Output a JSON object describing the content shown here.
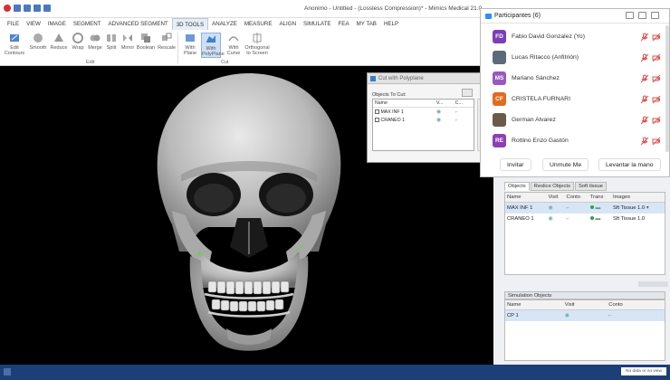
{
  "window": {
    "title": "Anonimo - Untitled - (Lossless Compression)* - Mimics Medical 21.0"
  },
  "menu": {
    "items": [
      "FILE",
      "VIEW",
      "IMAGE",
      "SEGMENT",
      "ADVANCED SEGMENT",
      "3D TOOLS",
      "ANALYZE",
      "MEASURE",
      "ALIGN",
      "SIMULATE",
      "FEA",
      "MY TAB",
      "HELP"
    ],
    "active": "3D TOOLS"
  },
  "ribbon": {
    "edit_tools": [
      "Edit Contours",
      "Smooth",
      "Reduce",
      "Wrap",
      "Merge",
      "Split",
      "Mirror",
      "Boolean",
      "Rescale"
    ],
    "edit_group": "Edit",
    "cut_tools": [
      "With Plane",
      "With PolyPlane",
      "With Curve",
      "Orthogonal to Screen"
    ],
    "cut_group": "Cut",
    "selected_tool": "With PolyPlane"
  },
  "cut_dialog": {
    "title": "Cut with Polyplane",
    "objects_label": "Objects To Cut:",
    "columns": [
      "Name",
      "V...",
      "C..."
    ],
    "rows": [
      {
        "name": "MAX INF 1"
      },
      {
        "name": "CRANEO 1"
      }
    ]
  },
  "participants": {
    "title": "Participantes (6)",
    "people": [
      {
        "initials": "FD",
        "name": "Fabio David Gonzalez (Yo)",
        "color": "#7b3fb3",
        "photo": false
      },
      {
        "initials": "",
        "name": "Lucas Ritacco (Anfitrión)",
        "color": "#5b6b7a",
        "photo": true
      },
      {
        "initials": "MS",
        "name": "Mariano Sánchez",
        "color": "#9a57c2",
        "photo": false
      },
      {
        "initials": "CF",
        "name": "CRISTELA FURNARI",
        "color": "#e06c1f",
        "photo": false
      },
      {
        "initials": "",
        "name": "German Alvarez",
        "color": "#6a5a4a",
        "photo": true
      },
      {
        "initials": "RE",
        "name": "Rottino Enzo Gastón",
        "color": "#8d3fb5",
        "photo": false
      }
    ],
    "buttons": [
      "Invitar",
      "Unmute Me",
      "Levantar la mano"
    ]
  },
  "project_panel": {
    "tabs": [
      "Objects",
      "Reslice Objects",
      "Soft tissue"
    ],
    "active_tab": "Objects",
    "columns": [
      "Name",
      "Visit",
      "Conto",
      "Trans",
      "Images"
    ],
    "rows": [
      {
        "name": "MAX INF 1",
        "image": "Sft Tissue 1.0"
      },
      {
        "name": "CRANEO 1",
        "image": "Sft Tissue 1.0"
      }
    ],
    "simulation_label": "Simulation Objects",
    "sim_columns": [
      "Name",
      "Visit",
      "Conto"
    ],
    "sim_rows": [
      {
        "name": "CP 1"
      }
    ]
  },
  "status_bar": {
    "text": "No data or no view"
  }
}
